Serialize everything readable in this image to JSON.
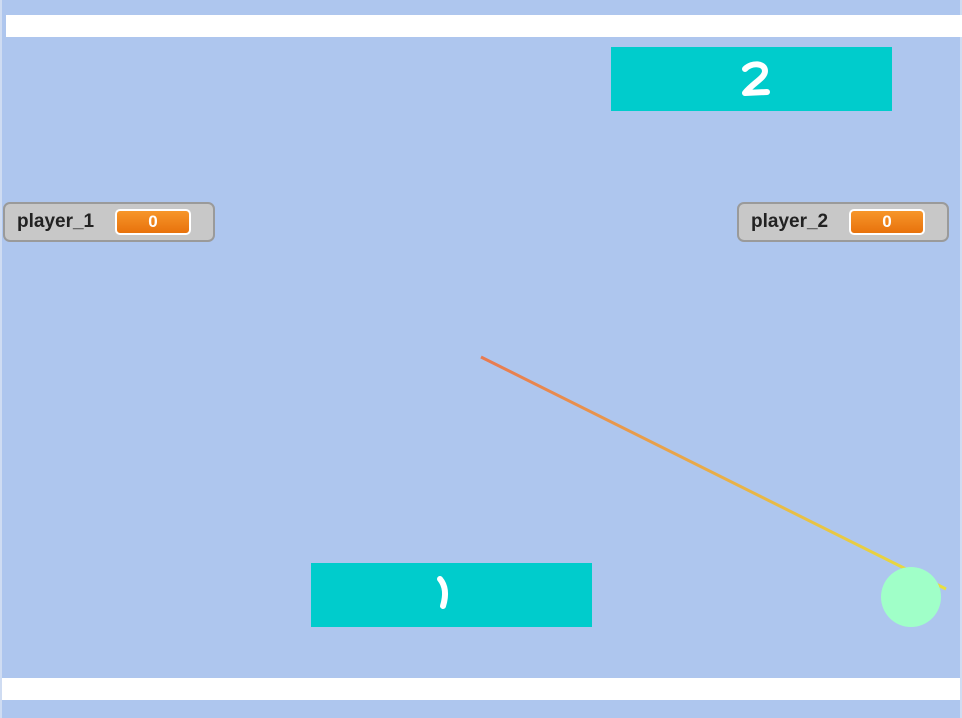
{
  "game": {
    "title": "",
    "background_color": "#aec6ee",
    "paddle_color": "#00cccc",
    "ball_color": "#a0ffc8",
    "trail_colors": [
      "#e87a50",
      "#e8e040"
    ]
  },
  "paddles": {
    "top": {
      "number": "2"
    },
    "bottom": {
      "number": "1"
    }
  },
  "monitors": {
    "player_1": {
      "label": "player_1",
      "value": "0"
    },
    "player_2": {
      "label": "player_2",
      "value": "0"
    }
  },
  "icons": {
    "ball": "ball-icon",
    "trail": "pen-trail"
  }
}
